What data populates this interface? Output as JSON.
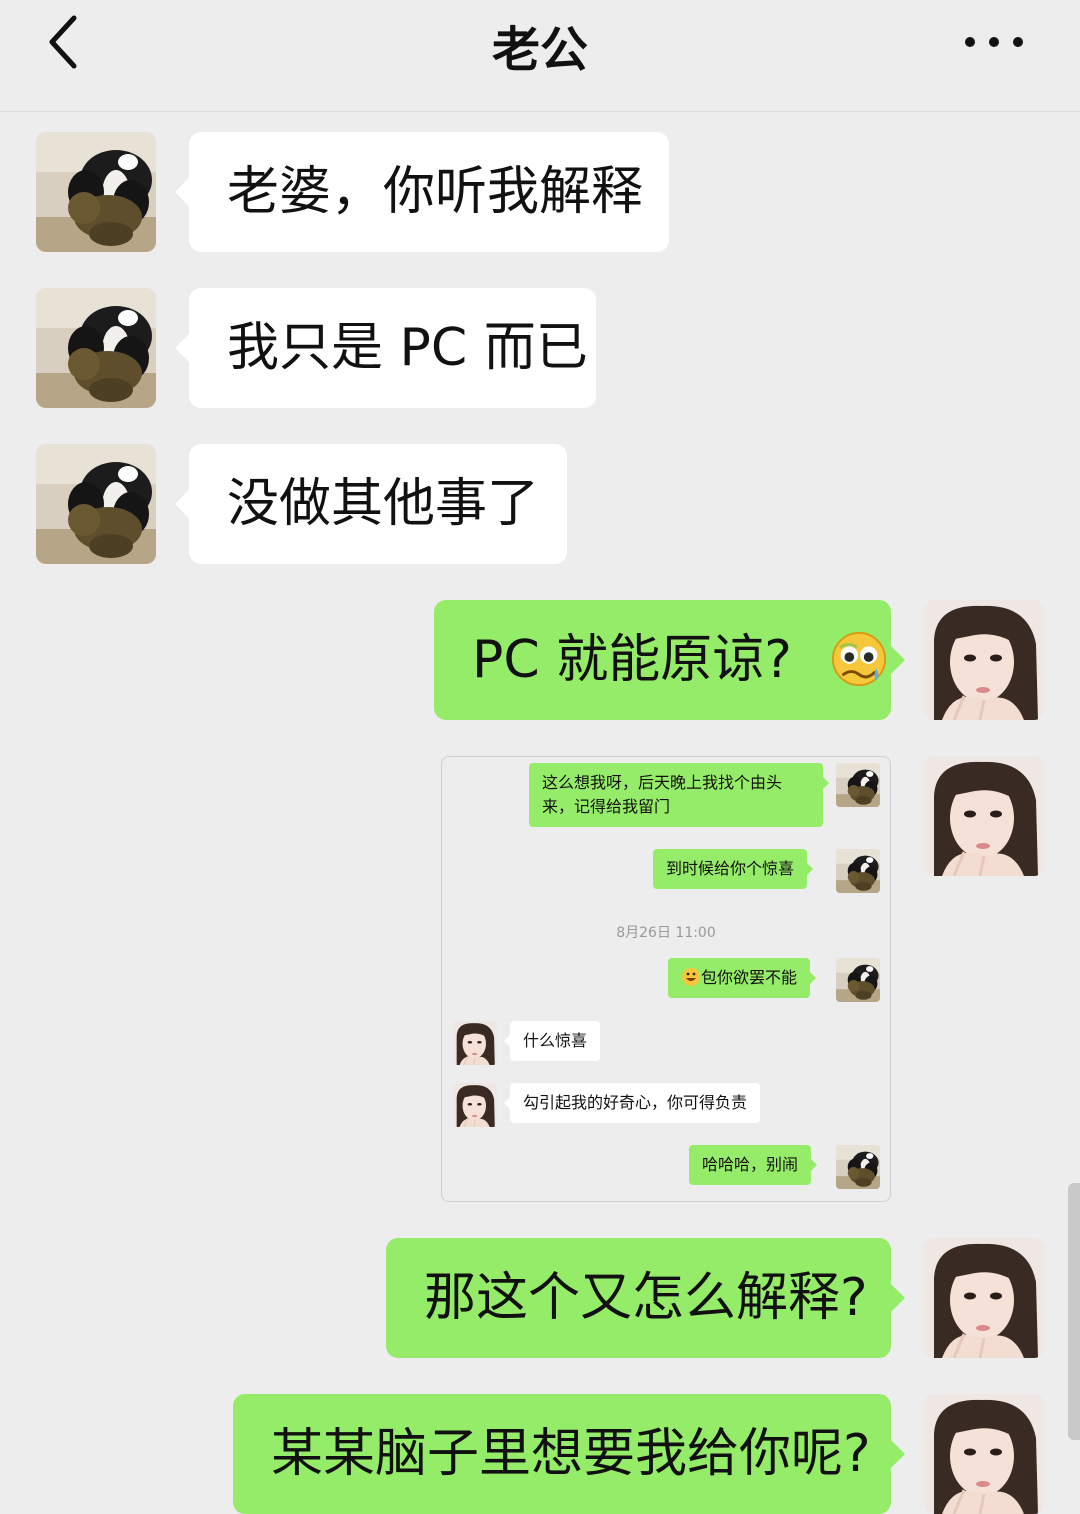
{
  "header": {
    "title": "老公"
  },
  "messages": [
    {
      "side": "in",
      "text": "老婆，你听我解释"
    },
    {
      "side": "in",
      "text": "我只是 PC 而已"
    },
    {
      "side": "in",
      "text": "没做其他事了"
    },
    {
      "side": "out",
      "text": "PC 就能原谅?",
      "emoji": "woozy-face-icon"
    },
    {
      "side": "out",
      "type": "screenshot"
    },
    {
      "side": "out",
      "text": "那这个又怎么解释?"
    },
    {
      "side": "out",
      "text": "某某脑子里想要我给你呢?"
    }
  ],
  "screenshot": {
    "messages": [
      {
        "side": "out",
        "lines": [
          "这么想我呀，后天晚上我找个由头",
          "来，记得给我留门"
        ]
      },
      {
        "side": "out",
        "text": "到时候给你个惊喜"
      },
      {
        "type": "time",
        "text": "8月26日 11:00"
      },
      {
        "side": "out",
        "text": "包你欲罢不能",
        "emoji": "grinning-face-icon"
      },
      {
        "side": "in",
        "text": "什么惊喜"
      },
      {
        "side": "in",
        "text": "勾引起我的好奇心，你可得负责"
      },
      {
        "side": "out",
        "text": "哈哈哈，别闹"
      }
    ]
  },
  "colors": {
    "background": "#ededed",
    "incoming_bubble": "#ffffff",
    "outgoing_bubble": "#95ec69",
    "text": "#111111"
  }
}
